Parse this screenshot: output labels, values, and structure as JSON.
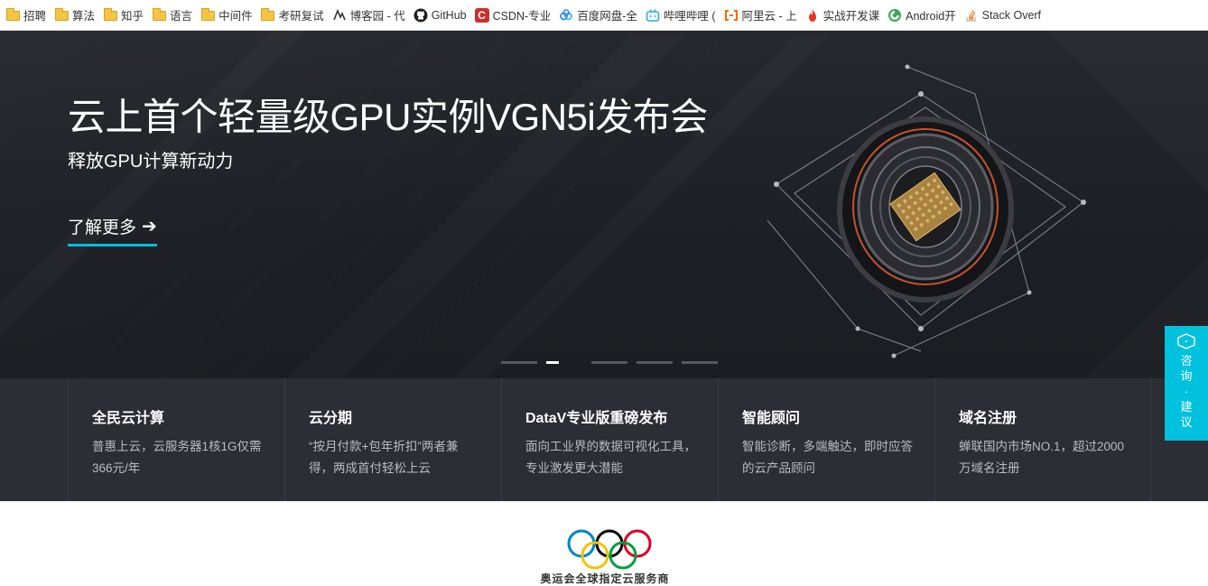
{
  "bookmarks": [
    {
      "label": "招聘",
      "icon": "folder-icon"
    },
    {
      "label": "算法",
      "icon": "folder-icon"
    },
    {
      "label": "知乎",
      "icon": "folder-icon"
    },
    {
      "label": "语言",
      "icon": "folder-icon"
    },
    {
      "label": "中间件",
      "icon": "folder-icon"
    },
    {
      "label": "考研复试",
      "icon": "folder-icon"
    },
    {
      "label": "博客园 - 代",
      "icon": "cnblogs-icon"
    },
    {
      "label": "GitHub",
      "icon": "github-icon"
    },
    {
      "label": "CSDN-专业",
      "icon": "csdn-icon"
    },
    {
      "label": "百度网盘-全",
      "icon": "baidu-netdisk-icon"
    },
    {
      "label": "哔哩哔哩 (",
      "icon": "bilibili-icon"
    },
    {
      "label": "阿里云 - 上",
      "icon": "aliyun-icon"
    },
    {
      "label": "实战开发课",
      "icon": "fire-icon"
    },
    {
      "label": "Android开",
      "icon": "android-icon"
    },
    {
      "label": "Stack Overf",
      "icon": "stackoverflow-icon"
    }
  ],
  "hero": {
    "title": "云上首个轻量级GPU实例VGN5i发布会",
    "subtitle": "释放GPU计算新动力",
    "link_label": "了解更多",
    "arrow": "➔",
    "active_slide": 2,
    "slide_count": 5
  },
  "features": [
    {
      "title": "全民云计算",
      "desc": "普惠上云，云服务器1核1G仅需366元/年"
    },
    {
      "title": "云分期",
      "desc": "“按月付款+包年折扣”两者兼得，两成首付轻松上云"
    },
    {
      "title": "DataV专业版重磅发布",
      "desc": "面向工业界的数据可视化工具，专业激发更大潜能"
    },
    {
      "title": "智能顾问",
      "desc": "智能诊断，多端触达，即时应答的云产品顾问"
    },
    {
      "title": "域名注册",
      "desc": "蝉联国内市场NO.1，超过2000万域名注册"
    }
  ],
  "consult": {
    "label": "咨询·建议"
  },
  "olympic": {
    "text": "奥运会全球指定云服务商"
  },
  "colors": {
    "accent": "#00c1de",
    "hero_bg": "#1f2126",
    "features_bg": "#2c2e35"
  }
}
